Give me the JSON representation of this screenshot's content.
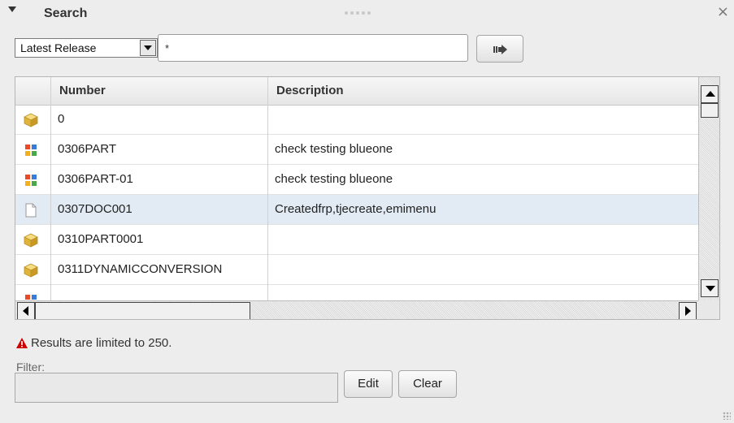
{
  "panel": {
    "title": "Search",
    "close_glyph": "×"
  },
  "search": {
    "scope_value": "Latest Release",
    "query_value": "*"
  },
  "grid": {
    "columns": [
      "Number",
      "Description"
    ],
    "rows": [
      {
        "icon": "part-cube-icon",
        "number": "0",
        "description": "",
        "selected": false
      },
      {
        "icon": "assembly-icon",
        "number": "0306PART",
        "description": "check testing blueone",
        "selected": false
      },
      {
        "icon": "assembly-icon",
        "number": "0306PART-01",
        "description": "check testing blueone",
        "selected": false
      },
      {
        "icon": "document-icon",
        "number": "0307DOC001",
        "description": "Createdfrp,tjecreate,emimenu",
        "selected": true
      },
      {
        "icon": "part-cube-icon",
        "number": "0310PART0001",
        "description": "",
        "selected": false
      },
      {
        "icon": "part-cube-icon",
        "number": "0311DYNAMICCONVERSION",
        "description": "",
        "selected": false
      }
    ]
  },
  "footer": {
    "limit_message": "Results are limited to 250.",
    "filter_label": "Filter:",
    "edit_label": "Edit",
    "clear_label": "Clear"
  },
  "colors": {
    "selected_row": "#e2ebf4",
    "warning": "#cc0000",
    "cube": "#f0c24a"
  }
}
